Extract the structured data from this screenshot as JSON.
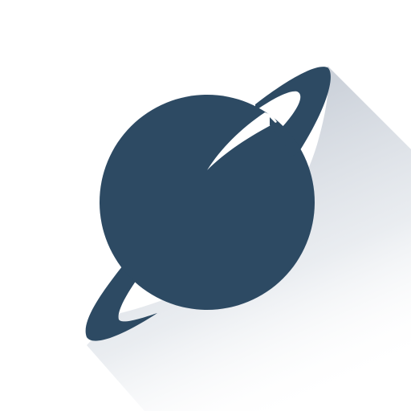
{
  "logo": {
    "icon": "planet-with-ring-icon",
    "colors": {
      "planet": "#2d4a63",
      "background": "#ffffff",
      "shadow": "#dde1e7"
    }
  }
}
